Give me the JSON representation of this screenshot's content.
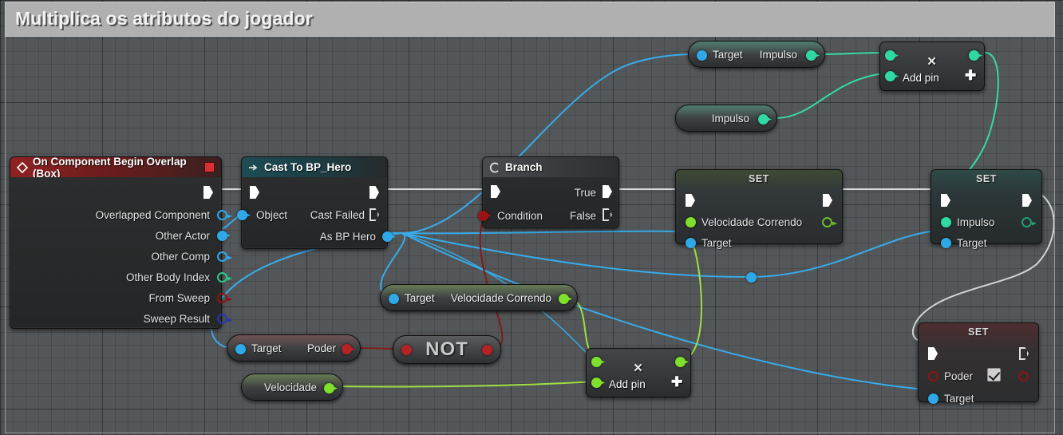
{
  "comment": {
    "title": "Multiplica os atributos do jogador"
  },
  "colors": {
    "exec_white": "#ffffff",
    "object_blue": "#2fa8e8",
    "bool_red": "#8c1414",
    "float_green": "#7ee02a",
    "vector_teal": "#2fe0a8",
    "int_green": "#1f9e6e",
    "struct_darkblue": "#1b2fa0",
    "comment_bar": "#b0b0b0"
  },
  "nodes": {
    "event_overlap": {
      "title": "On Component Begin Overlap (Box)",
      "header_color": "#8f2222",
      "outputs": [
        {
          "label": "Overlapped Component",
          "pin": "object-pin",
          "style": "hollow",
          "color": "#2fa8e8"
        },
        {
          "label": "Other Actor",
          "pin": "object-pin",
          "style": "solid",
          "color": "#2fa8e8"
        },
        {
          "label": "Other Comp",
          "pin": "object-pin",
          "style": "hollow",
          "color": "#2fa8e8"
        },
        {
          "label": "Other Body Index",
          "pin": "int-pin",
          "style": "hollow",
          "color": "#2ac98a"
        },
        {
          "label": "From Sweep",
          "pin": "bool-pin",
          "style": "hollow",
          "color": "#8c1414"
        },
        {
          "label": "Sweep Result",
          "pin": "struct-pin",
          "style": "hollow",
          "color": "#2436a8"
        }
      ]
    },
    "cast_node": {
      "title": "Cast To BP_Hero",
      "input_label": "Object",
      "out_failed": "Cast Failed",
      "out_as": "As BP Hero"
    },
    "branch_node": {
      "title": "Branch",
      "condition": "Condition",
      "true": "True",
      "false": "False"
    },
    "set_velocidade": {
      "title": "SET",
      "prop": "Velocidade Correndo",
      "target": "Target"
    },
    "set_impulso": {
      "title": "SET",
      "prop": "Impulso",
      "target": "Target"
    },
    "set_poder": {
      "title": "SET",
      "prop": "Poder",
      "target": "Target",
      "value_checked": true
    },
    "get_impulso_target": {
      "target": "Target",
      "out": "Impulso"
    },
    "get_impulso_plain": {
      "out": "Impulso"
    },
    "get_velocidade_correndo": {
      "target": "Target",
      "out": "Velocidade Correndo"
    },
    "get_poder": {
      "target": "Target",
      "out": "Poder"
    },
    "get_velocidade": {
      "out": "Velocidade"
    },
    "not_node": {
      "label": "NOT"
    },
    "multiply_top": {
      "op": "×",
      "add_pin": "Add pin",
      "plus": "✚"
    },
    "multiply_bottom": {
      "op": "×",
      "add_pin": "Add pin",
      "plus": "✚"
    }
  }
}
